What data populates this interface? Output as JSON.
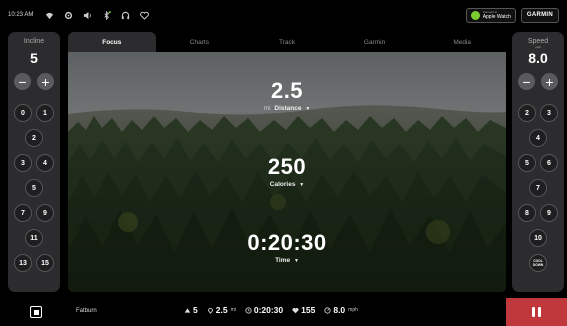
{
  "status_bar": {
    "time": "10:23 AM",
    "icons": [
      "wifi-icon",
      "settings-icon",
      "volume-icon",
      "bluetooth-icon",
      "headphones-icon",
      "heart-icon"
    ],
    "apple_watch": {
      "small": "Connect to",
      "label": "Apple Watch"
    },
    "garmin_label": "GARMIN"
  },
  "incline": {
    "title": "Incline",
    "unit": "",
    "value": "5",
    "minus": "−",
    "plus": "+",
    "presets": [
      "0",
      "1",
      "2",
      "3",
      "4",
      "5",
      "7",
      "9",
      "11",
      "13",
      "15"
    ]
  },
  "speed": {
    "title": "Speed",
    "unit": "mph",
    "value": "8.0",
    "minus": "−",
    "plus": "+",
    "presets": [
      "2",
      "3",
      "4",
      "5",
      "6",
      "7",
      "8",
      "9",
      "10"
    ],
    "cool_down": {
      "line1": "COOL",
      "line2": "DOWN"
    }
  },
  "tabs": [
    "Focus",
    "Charts",
    "Track",
    "Garmin",
    "Media"
  ],
  "metrics": {
    "distance": {
      "value": "2.5",
      "unit": "mi",
      "label": "Distance"
    },
    "calories": {
      "value": "250",
      "label": "Calories"
    },
    "time": {
      "value": "0:20:30",
      "label": "Time"
    }
  },
  "bottom": {
    "workout": "Fatburn",
    "incline": "5",
    "distance": "2.5",
    "distance_unit": "mi",
    "elapsed": "0:20:30",
    "heart_rate": "155",
    "speed": "8.0",
    "speed_unit": "mph"
  },
  "colors": {
    "accent_pause": "#c0383c",
    "panel": "#2c2c2e",
    "watch_green": "#7ccc2f"
  }
}
